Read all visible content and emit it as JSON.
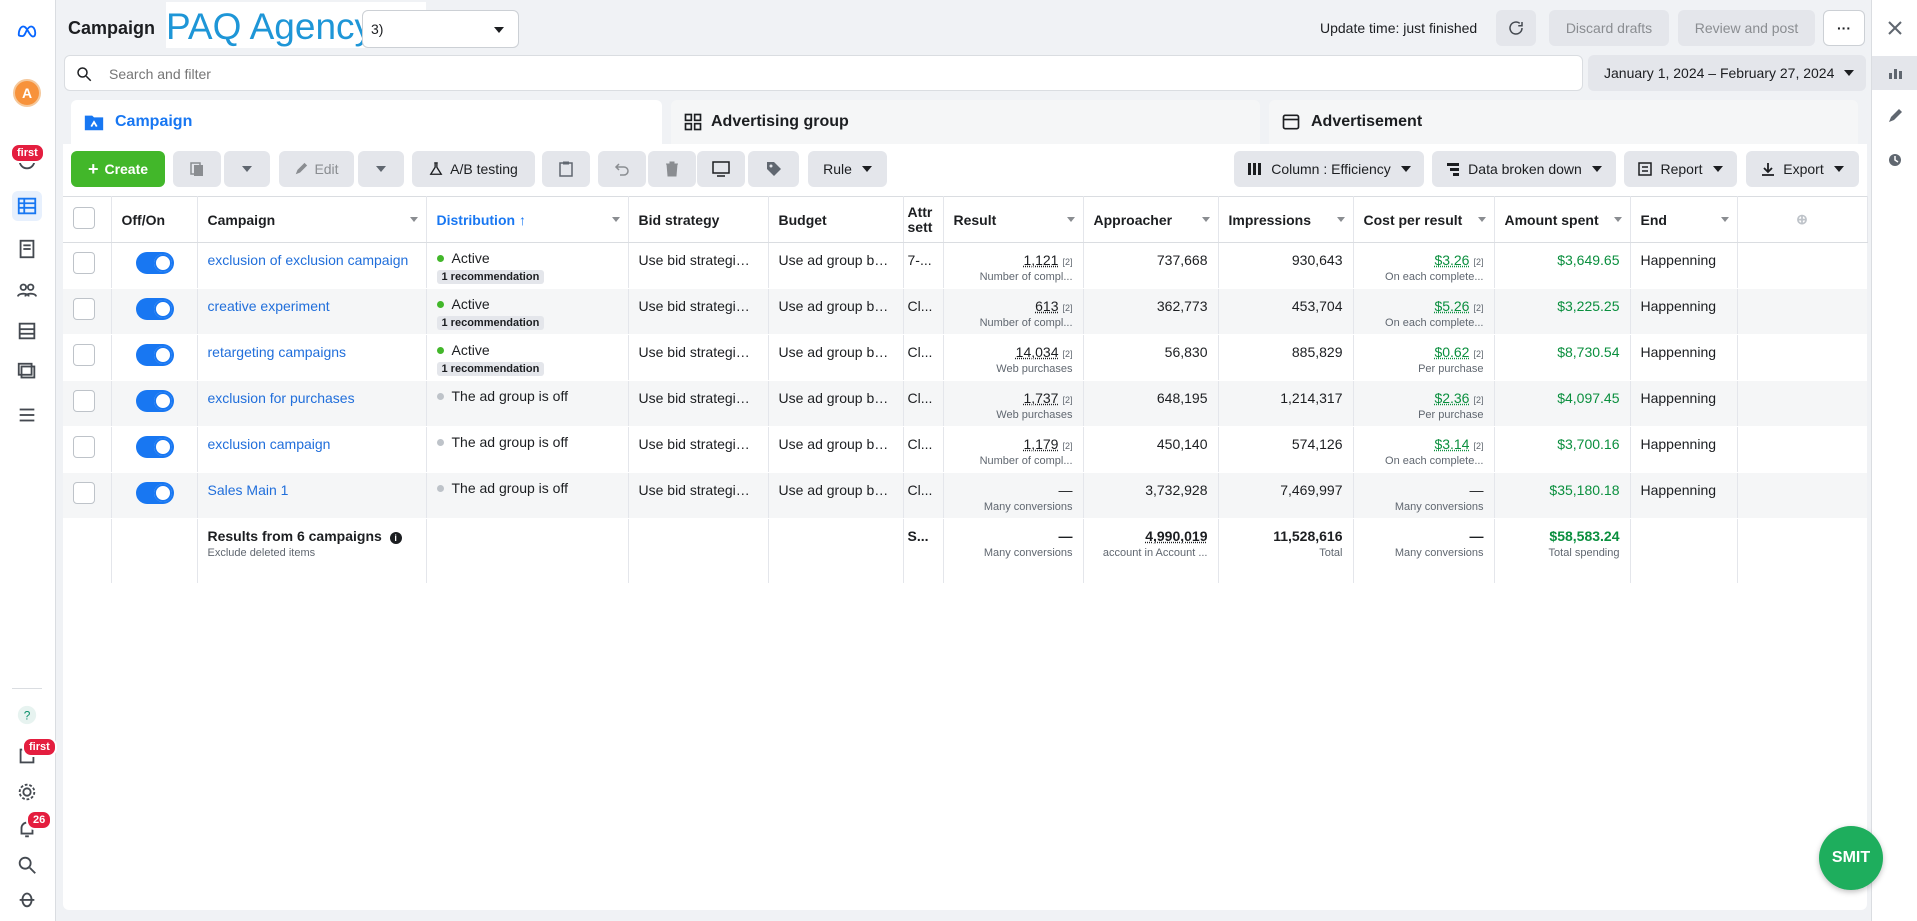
{
  "header": {
    "page_title": "Campaign",
    "agency_name": "PAQ Agency",
    "account_selector_suffix": "3)",
    "update_time": "Update time: just finished",
    "discard_label": "Discard drafts",
    "review_label": "Review and post",
    "more_label": "···"
  },
  "search": {
    "placeholder": "Search and filter"
  },
  "date_range": "January 1, 2024 – February 27, 2024",
  "tabs": [
    {
      "label": "Campaign",
      "active": true
    },
    {
      "label": "Advertising group",
      "active": false
    },
    {
      "label": "Advertisement",
      "active": false
    }
  ],
  "toolbar": {
    "create_label": "Create",
    "edit_label": "Edit",
    "ab_label": "A/B testing",
    "rule_label": "Rule",
    "columns_label": "Column : Efficiency",
    "breakdown_label": "Data broken down",
    "report_label": "Report",
    "export_label": "Export"
  },
  "left_rail": {
    "avatar_letter": "A",
    "badge_first": "first",
    "badge_first2": "first",
    "badge_notifications": "26"
  },
  "fab_label": "SMIT",
  "table": {
    "headers": [
      "Off/On",
      "Campaign",
      "Distribution",
      "Bid strategy",
      "Budget",
      "Attr sett",
      "Result",
      "Approacher",
      "Impressions",
      "Cost per result",
      "Amount spent",
      "End"
    ],
    "rows": [
      {
        "campaign": "exclusion of exclusion campaign",
        "status": "Active",
        "status_color": "#42b72a",
        "recommendation": "1 recommendation",
        "bid": "Use bid strategies...",
        "budget": "Use ad group bu...",
        "attr": "7-...",
        "result": "1,121",
        "result_sup": "[2]",
        "result_sub": "Number of compl...",
        "approacher": "737,668",
        "impressions": "930,643",
        "cpr": "$3.26",
        "cpr_sup": "[2]",
        "cpr_sub": "On each complete...",
        "spent": "$3,649.65",
        "end": "Happenning"
      },
      {
        "campaign": "creative experiment",
        "status": "Active",
        "status_color": "#42b72a",
        "recommendation": "1 recommendation",
        "bid": "Use bid strategies...",
        "budget": "Use ad group bu...",
        "attr": "Cl...",
        "result": "613",
        "result_sup": "[2]",
        "result_sub": "Number of compl...",
        "approacher": "362,773",
        "impressions": "453,704",
        "cpr": "$5.26",
        "cpr_sup": "[2]",
        "cpr_sub": "On each complete...",
        "spent": "$3,225.25",
        "end": "Happenning"
      },
      {
        "campaign": "retargeting campaigns",
        "status": "Active",
        "status_color": "#42b72a",
        "recommendation": "1 recommendation",
        "bid": "Use bid strategies...",
        "budget": "Use ad group bu...",
        "attr": "Cl...",
        "result": "14,034",
        "result_sup": "[2]",
        "result_sub": "Web purchases",
        "approacher": "56,830",
        "impressions": "885,829",
        "cpr": "$0.62",
        "cpr_sup": "[2]",
        "cpr_sub": "Per purchase",
        "spent": "$8,730.54",
        "end": "Happenning"
      },
      {
        "campaign": "exclusion for purchases",
        "status": "The ad group is off",
        "status_color": "#bec3c9",
        "recommendation": "",
        "bid": "Use bid strategies...",
        "budget": "Use ad group bu...",
        "attr": "Cl...",
        "result": "1,737",
        "result_sup": "[2]",
        "result_sub": "Web purchases",
        "approacher": "648,195",
        "impressions": "1,214,317",
        "cpr": "$2.36",
        "cpr_sup": "[2]",
        "cpr_sub": "Per purchase",
        "spent": "$4,097.45",
        "end": "Happenning"
      },
      {
        "campaign": "exclusion campaign",
        "status": "The ad group is off",
        "status_color": "#bec3c9",
        "recommendation": "",
        "bid": "Use bid strategies...",
        "budget": "Use ad group bu...",
        "attr": "Cl...",
        "result": "1,179",
        "result_sup": "[2]",
        "result_sub": "Number of compl...",
        "approacher": "450,140",
        "impressions": "574,126",
        "cpr": "$3.14",
        "cpr_sup": "[2]",
        "cpr_sub": "On each complete...",
        "spent": "$3,700.16",
        "end": "Happenning"
      },
      {
        "campaign": "Sales Main 1",
        "status": "The ad group is off",
        "status_color": "#bec3c9",
        "recommendation": "",
        "bid": "Use bid strategies...",
        "budget": "Use ad group bu...",
        "attr": "Cl...",
        "result": "—",
        "result_sup": "",
        "result_sub": "Many conversions",
        "approacher": "3,732,928",
        "impressions": "7,469,997",
        "cpr": "—",
        "cpr_sup": "",
        "cpr_sub": "Many conversions",
        "spent": "$35,180.18",
        "end": "Happenning"
      }
    ],
    "footer": {
      "label": "Results from 6 campaigns",
      "sub": "Exclude deleted items",
      "attr": "S...",
      "result": "—",
      "result_sub": "Many conversions",
      "approacher": "4,990,019",
      "approacher_sub": "account in Account ...",
      "impressions": "11,528,616",
      "impressions_sub": "Total",
      "cpr": "—",
      "cpr_sub": "Many conversions",
      "spent": "$58,583.24",
      "spent_sub": "Total spending"
    }
  }
}
